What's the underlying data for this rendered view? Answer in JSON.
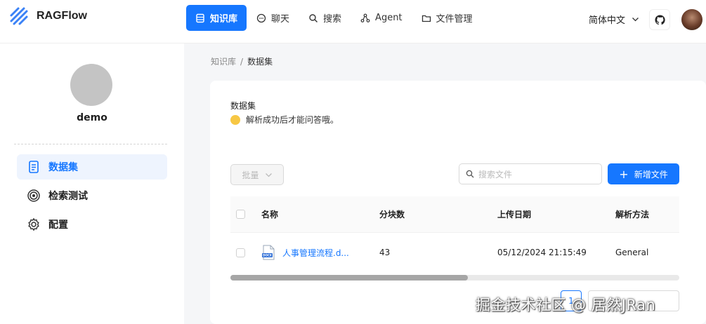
{
  "app": {
    "name": "RAGFlow"
  },
  "nav": [
    {
      "label": "知识库",
      "icon": "database-icon",
      "active": true
    },
    {
      "label": "聊天",
      "icon": "chat-icon",
      "active": false
    },
    {
      "label": "搜索",
      "icon": "search-icon",
      "active": false
    },
    {
      "label": "Agent",
      "icon": "graph-icon",
      "active": false
    },
    {
      "label": "文件管理",
      "icon": "folder-icon",
      "active": false
    }
  ],
  "header": {
    "language": "简体中文"
  },
  "sidebar": {
    "name": "demo",
    "items": [
      {
        "label": "数据集",
        "icon": "document-icon",
        "active": true
      },
      {
        "label": "检索测试",
        "icon": "target-icon",
        "active": false
      },
      {
        "label": "配置",
        "icon": "gear-icon",
        "active": false
      }
    ]
  },
  "breadcrumb": {
    "root": "知识库",
    "current": "数据集"
  },
  "dataset": {
    "title": "数据集",
    "description": "解析成功后才能问答哦。",
    "batch_label": "批量",
    "search_placeholder": "搜索文件",
    "add_label": "新增文件"
  },
  "table": {
    "columns": [
      "名称",
      "分块数",
      "上传日期",
      "解析方法"
    ],
    "rows": [
      {
        "name": "人事管理流程.d...",
        "chunks": "43",
        "date": "05/12/2024 21:15:49",
        "method": "General"
      }
    ]
  },
  "pagination": {
    "current_page": "1"
  },
  "watermark": "掘金技术社区 @ 居然JRan",
  "colors": {
    "accent": "#1677ff"
  }
}
